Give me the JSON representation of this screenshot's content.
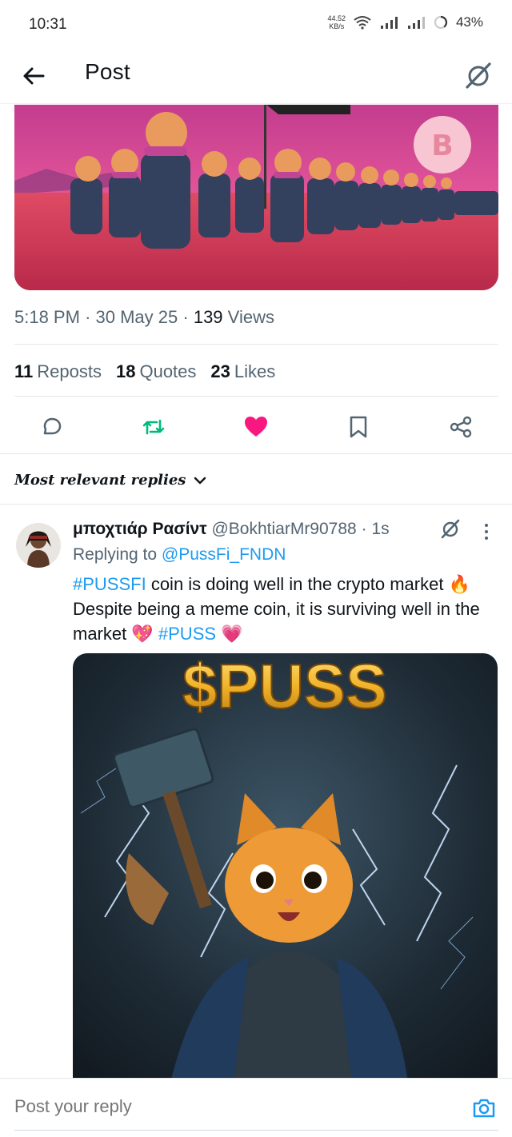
{
  "status_bar": {
    "time": "10:31",
    "net_speed_value": "44.52",
    "net_speed_unit": "KB/s",
    "battery": "43%"
  },
  "header": {
    "title": "Post",
    "icons": [
      "back-arrow-icon",
      "grok-icon"
    ]
  },
  "post": {
    "meta": {
      "time": "5:18 PM",
      "date": "30 May 25",
      "views_count": "139",
      "views_label": "Views"
    },
    "stats": [
      {
        "count": "11",
        "label": "Reposts"
      },
      {
        "count": "18",
        "label": "Quotes"
      },
      {
        "count": "23",
        "label": "Likes"
      }
    ],
    "actions": [
      "reply-icon",
      "repost-icon",
      "like-icon",
      "bookmark-icon",
      "share-icon"
    ],
    "colors": {
      "repost": "#00ba7c",
      "like": "#f91880",
      "icon": "#536471"
    }
  },
  "replies_heading": "Most relevant replies",
  "reply": {
    "name": "μποχτιάρ Ρασίντ",
    "handle": "@BokhtiarMr90788",
    "time": "1s",
    "replying_prefix": "Replying to",
    "replying_to": "@PussFi_FNDN",
    "hashtag1": "#PUSSFI",
    "text1": " coin is doing well in the crypto market ",
    "emoji_fire": "🔥",
    "text2": " Despite being a meme coin, it is surviving well in the market ",
    "emoji_heart1": "💖",
    "hashtag2": "#PUSS",
    "emoji_heart2": "💗",
    "image_text": "$PUSS"
  },
  "composer": {
    "placeholder": "Post your reply"
  },
  "colors": {
    "accent": "#1d9bf0",
    "text": "#0f1419",
    "secondary": "#536471"
  }
}
